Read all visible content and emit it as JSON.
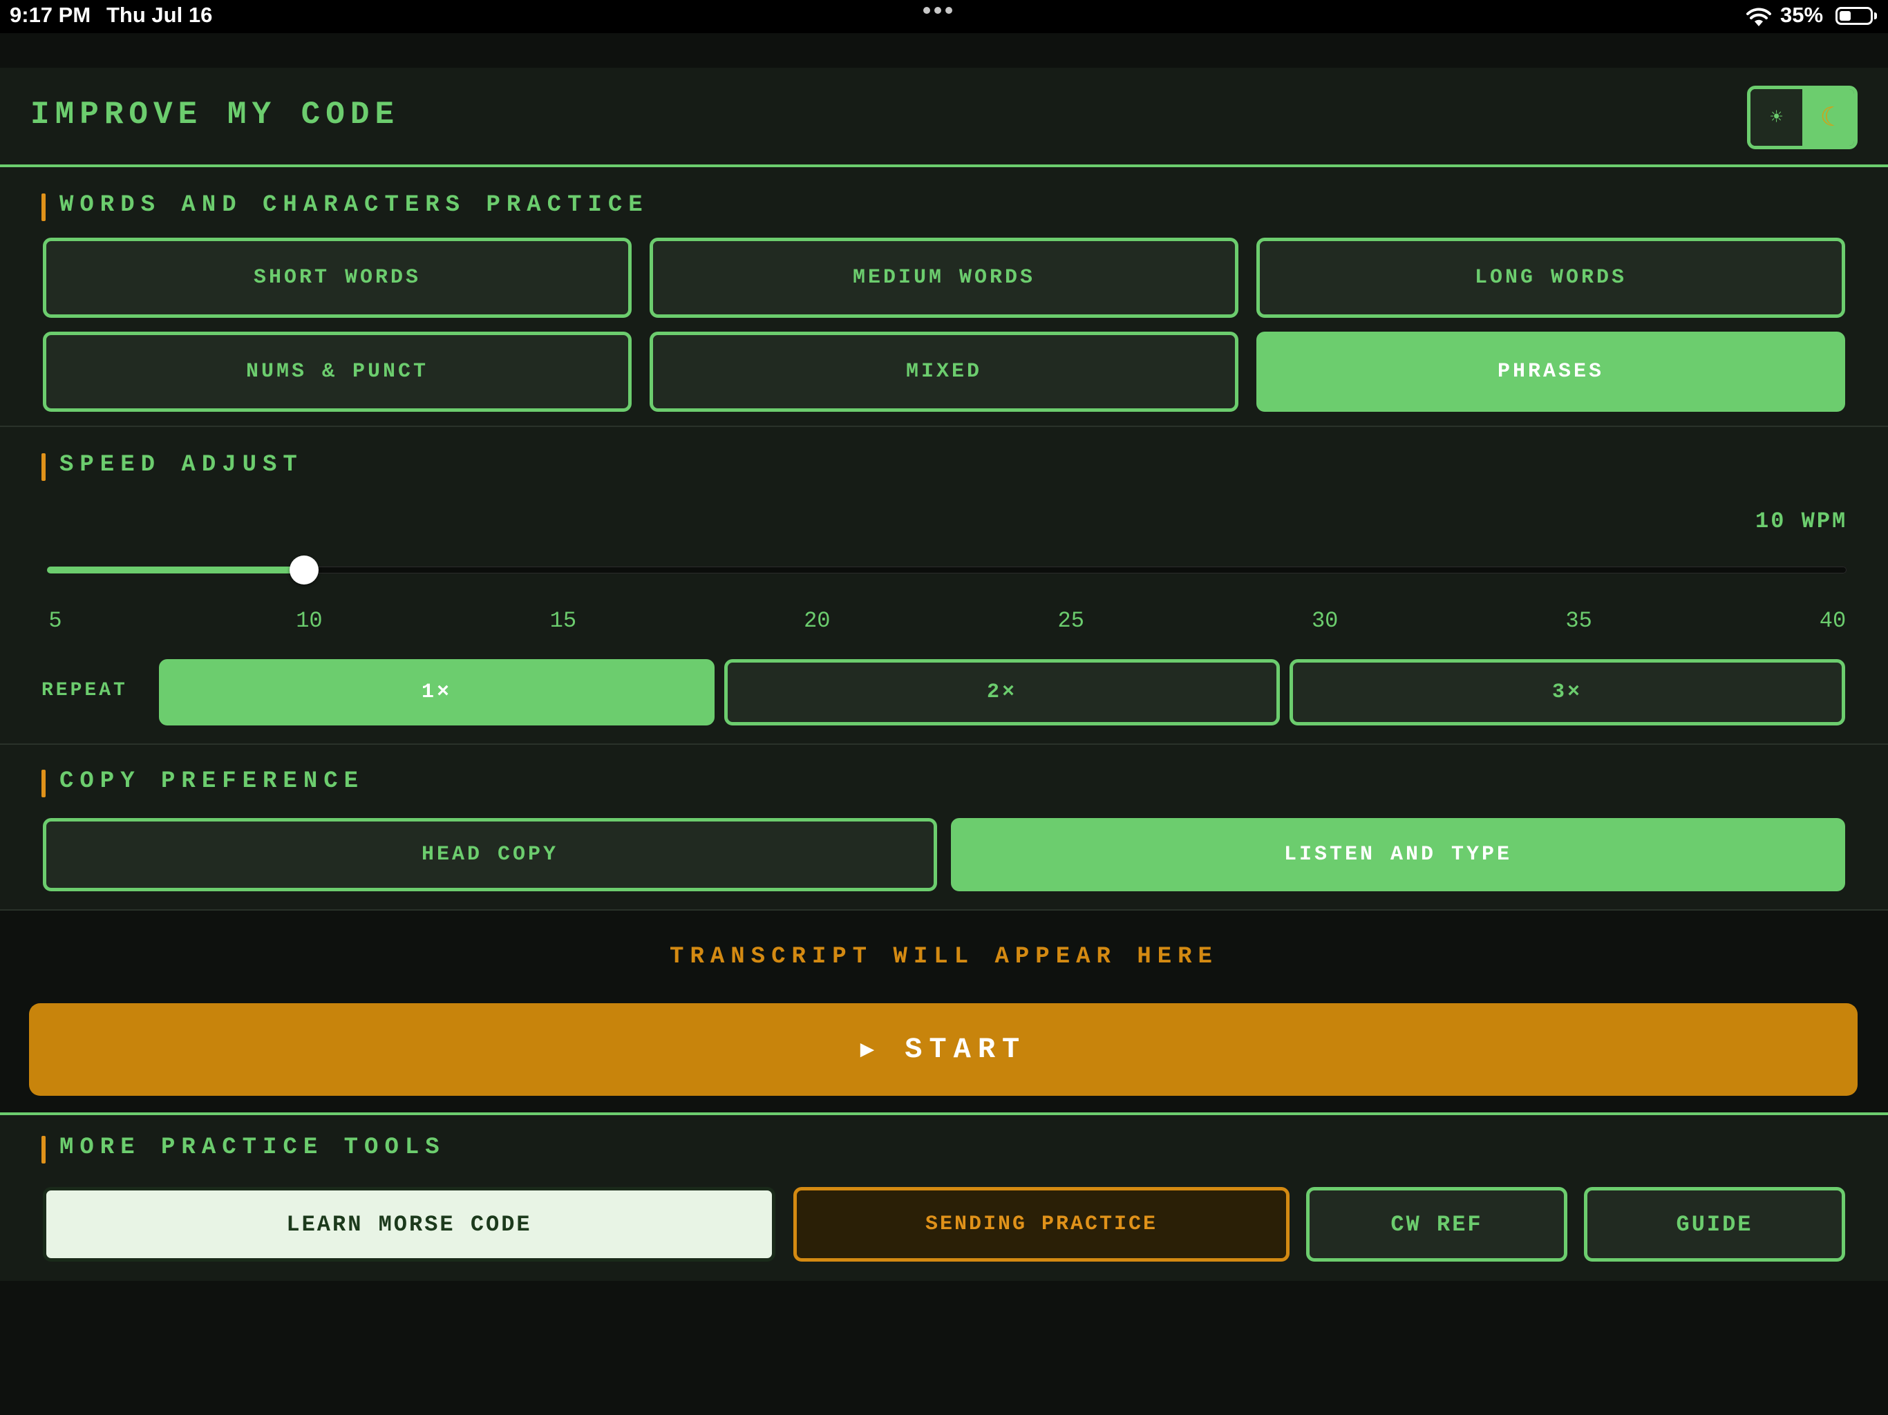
{
  "status_bar": {
    "time": "9:17 PM",
    "date": "Thu Jul 16",
    "battery": "35%"
  },
  "header": {
    "title": "IMPROVE MY CODE",
    "theme_light_icon": "☀",
    "theme_dark_icon": "☾"
  },
  "practice": {
    "title": "WORDS AND CHARACTERS PRACTICE",
    "options": [
      "SHORT WORDS",
      "MEDIUM WORDS",
      "LONG WORDS",
      "NUMS & PUNCT",
      "MIXED",
      "PHRASES"
    ],
    "selected": "PHRASES"
  },
  "speed": {
    "title": "SPEED ADJUST",
    "value_label": "10 WPM",
    "value": 10,
    "min": 5,
    "max": 40,
    "ticks": [
      "5",
      "10",
      "15",
      "20",
      "25",
      "30",
      "35",
      "40"
    ],
    "repeat_label": "REPEAT",
    "repeat_options": [
      "1×",
      "2×",
      "3×"
    ],
    "repeat_selected": "1×"
  },
  "copy": {
    "title": "COPY PREFERENCE",
    "options": [
      "HEAD COPY",
      "LISTEN AND TYPE"
    ],
    "selected": "LISTEN AND TYPE"
  },
  "transcript": {
    "placeholder": "TRANSCRIPT WILL APPEAR HERE"
  },
  "start": {
    "icon": "▶",
    "label": "START"
  },
  "tools": {
    "title": "MORE PRACTICE TOOLS",
    "items": [
      "LEARN MORSE CODE",
      "SENDING PRACTICE",
      "CW REF",
      "GUIDE"
    ]
  },
  "colors": {
    "accent": "#6ccd6e",
    "orange": "#c8840c",
    "background": "#0e110e",
    "panel": "#161c16"
  }
}
